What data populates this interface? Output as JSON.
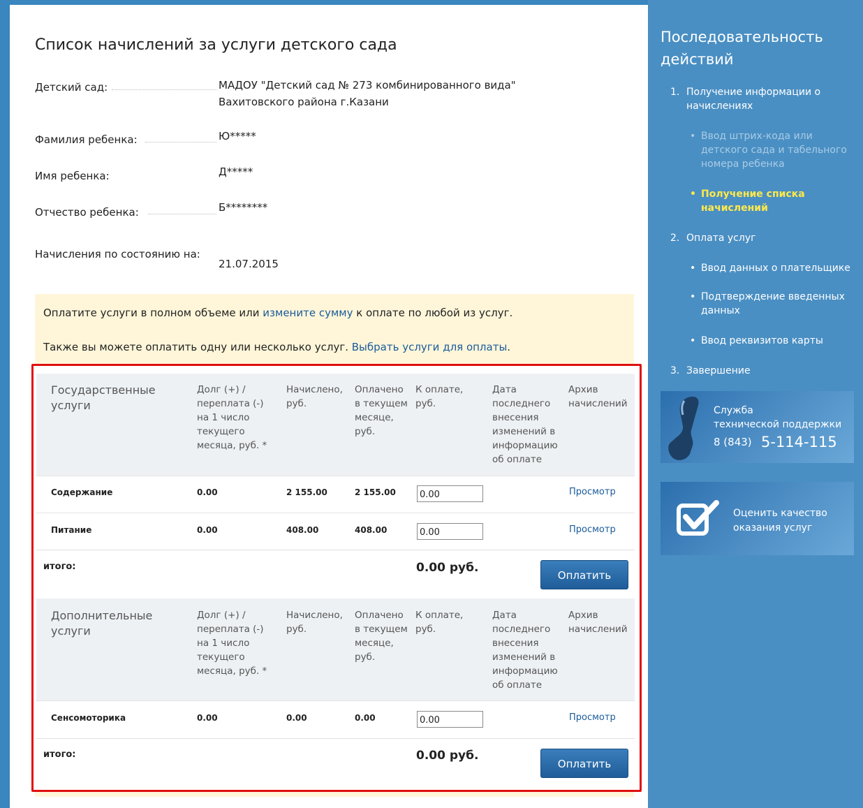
{
  "page": {
    "title": "Список начислений за услуги детского сада"
  },
  "info": {
    "kindergarten_label": "Детский сад:",
    "kindergarten_value": "МАДОУ \"Детский сад № 273 комбинированного вида\" Вахитовского района г.Казани",
    "surname_label": "Фамилия ребенка:",
    "surname_value": "Ю*****",
    "name_label": "Имя ребенка:",
    "name_value": "Д*****",
    "patronymic_label": "Отчество ребенка:",
    "patronymic_value": "Б********",
    "date_label": "Начисления по состоянию на:",
    "date_value": "21.07.2015"
  },
  "notice": {
    "line1_before": "Оплатите услуги в полном объеме или ",
    "line1_link": "измените сумму",
    "line1_after": " к оплате по любой из услуг.",
    "line2_before": "Также вы можете оплатить одну или несколько услуг. ",
    "line2_link": "Выбрать услуги для оплаты",
    "line2_after": "."
  },
  "columns": {
    "debt": "Долг (+) / переплата (-) на 1 число текущего месяца, руб. *",
    "accrued": "Начислено, руб.",
    "paid": "Оплачено в текущем месяце, руб.",
    "to_pay": "К оплате, руб.",
    "last_change": "Дата последнего внесения изменений в информацию об оплате",
    "archive": "Архив начислений"
  },
  "groups": [
    {
      "title": "Государственные услуги",
      "rows": [
        {
          "service": "Содержание",
          "debt": "0.00",
          "accrued": "2 155.00",
          "paid": "2 155.00",
          "to_pay": "0.00",
          "link": "Просмотр"
        },
        {
          "service": "Питание",
          "debt": "0.00",
          "accrued": "408.00",
          "paid": "408.00",
          "to_pay": "0.00",
          "link": "Просмотр"
        }
      ],
      "total_label": "итого:",
      "total_sum": "0.00 руб.",
      "button": "Оплатить"
    },
    {
      "title": "Дополнительные услуги",
      "rows": [
        {
          "service": "Сенсомоторика",
          "debt": "0.00",
          "accrued": "0.00",
          "paid": "0.00",
          "to_pay": "0.00",
          "link": "Просмотр"
        }
      ],
      "total_label": "итого:",
      "total_sum": "0.00 руб.",
      "button": "Оплатить"
    }
  ],
  "sidebar": {
    "title": "Последовательность действий",
    "step1": {
      "num": "1.",
      "label": "Получение информации о начислениях"
    },
    "step1_sub1": "Ввод штрих-кода или детского сада и табельного номера ребенка",
    "step1_sub2": "Получение списка начислений",
    "step2": {
      "num": "2.",
      "label": "Оплата услуг"
    },
    "step2_sub1": "Ввод данных о плательщике",
    "step2_sub2": "Подтверждение введенных данных",
    "step2_sub3": "Ввод реквизитов карты",
    "step3": {
      "num": "3.",
      "label": "Завершение"
    },
    "support": {
      "line1": "Служба",
      "line2": "технической поддержки",
      "phone_code": "8 (843)",
      "phone_number": "5-114-115"
    },
    "rate": {
      "line1": "Оценить качество",
      "line2": "оказания услуг"
    }
  },
  "colors": {
    "sidebar_bg": "#4a8fc3",
    "active_step": "#ffe94a",
    "link": "#1a5b9a",
    "highlight_border": "#e01010",
    "notice_bg": "#fff6d9"
  }
}
